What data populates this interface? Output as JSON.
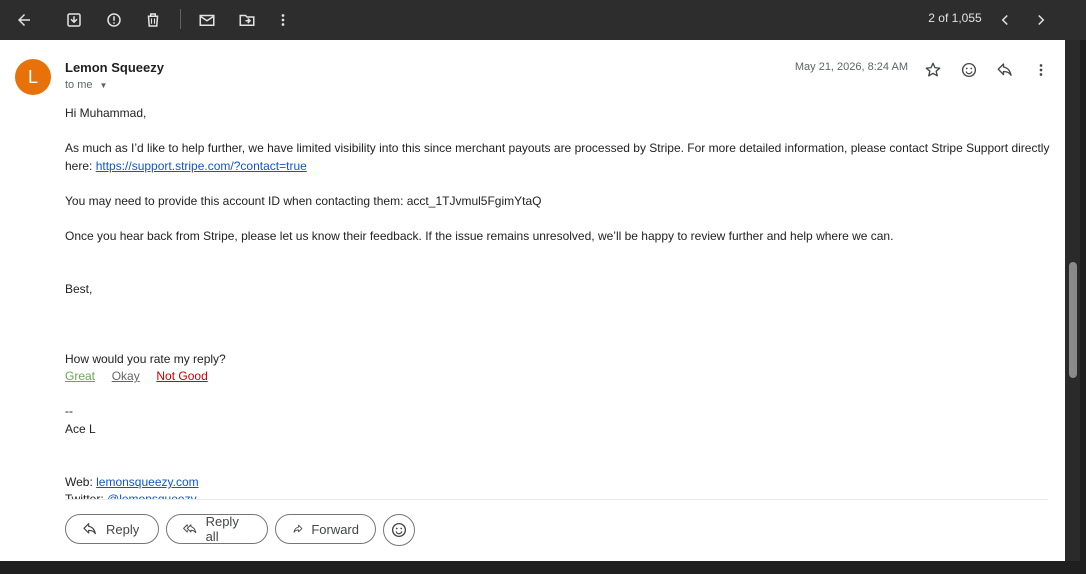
{
  "toolbar": {
    "icons": [
      "back-arrow-icon",
      "archive-icon",
      "report-spam-icon",
      "delete-icon",
      "mark-unread-icon",
      "move-to-icon",
      "more-vert-icon"
    ],
    "pager_count": "2 of 1,055"
  },
  "message": {
    "avatar_letter": "L",
    "sender": "Lemon Squeezy",
    "to_label": "to me",
    "date": "May 21, 2026, 8:24 AM",
    "avatar_color": "#e8710a"
  },
  "body": {
    "greeting": "Hi Muhammad,",
    "para1_line1": "As much as I’d like to help further, we have limited visibility into this since merchant payouts are processed by Stripe. For more detailed information, please contact Stripe Support directly",
    "para1_line2_prefix": "here: ",
    "support_link": "https://support.stripe.com/?contact=true",
    "para2": "You may need to provide this account ID when contacting them: acct_1TJvmul5FgimYtaQ",
    "para3": "Once you hear back from Stripe, please let us know their feedback. If the issue remains unresolved, we’ll be happy to review further and help where we can.",
    "signoff": "Best,",
    "rating_question": "How would you rate my reply?",
    "rating_great": "Great",
    "rating_okay": "Okay",
    "rating_notgood": "Not Good",
    "sig_dashes": "--",
    "sig_name": "Ace L",
    "web_label": "Web: ",
    "web_link": "lemonsqueezy.com",
    "twitter_label": "Twitter: ",
    "twitter_link": "@lemonsqueezy"
  },
  "actions": {
    "reply": "Reply",
    "reply_all": "Reply all",
    "forward": "Forward"
  }
}
